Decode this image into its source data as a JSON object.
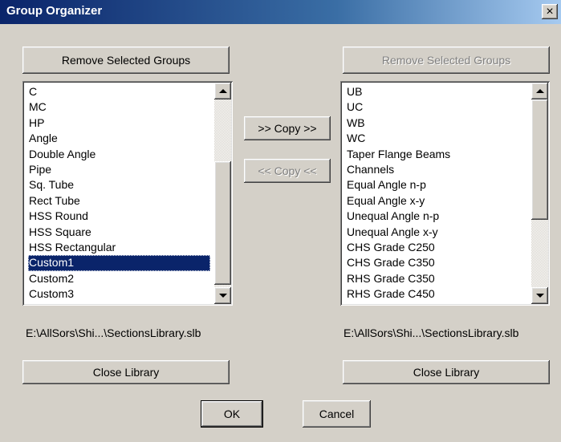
{
  "window": {
    "title": "Group Organizer",
    "close_glyph": "×"
  },
  "left_panel": {
    "remove_label": "Remove Selected Groups",
    "items": [
      "C",
      "MC",
      "HP",
      "Angle",
      "Double Angle",
      "Pipe",
      "Sq. Tube",
      "Rect Tube",
      "HSS Round",
      "HSS Square",
      "HSS Rectangular",
      "Custom1",
      "Custom2",
      "Custom3"
    ],
    "selected_index": 11,
    "path": "E:\\AllSors\\Shi...\\SectionsLibrary.slb",
    "close_label": "Close Library"
  },
  "right_panel": {
    "remove_label": "Remove Selected Groups",
    "items": [
      "UB",
      "UC",
      "WB",
      "WC",
      "Taper Flange Beams",
      "Channels",
      "Equal Angle n-p",
      "Equal Angle x-y",
      "Unequal Angle n-p",
      "Unequal Angle x-y",
      "CHS Grade C250",
      "CHS Grade C350",
      "RHS Grade C350",
      "RHS Grade C450"
    ],
    "path": "E:\\AllSors\\Shi...\\SectionsLibrary.slb",
    "close_label": "Close Library"
  },
  "copy_right_label": ">> Copy >>",
  "copy_left_label": "<< Copy <<",
  "ok_label": "OK",
  "cancel_label": "Cancel",
  "icons": {
    "close": "close-icon",
    "scroll_up": "scroll-up-arrow-icon",
    "scroll_down": "scroll-down-arrow-icon"
  }
}
